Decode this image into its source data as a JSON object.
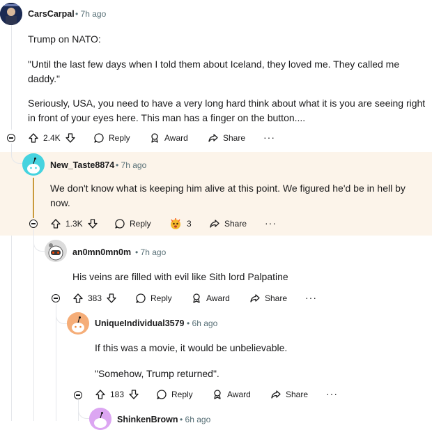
{
  "comments": [
    {
      "username": "CarsCarpal",
      "age": "7h ago",
      "paragraphs": [
        "Trump on NATO:",
        "\"Until the last few days when I told them about Iceland, they loved me. They called me daddy.\"",
        "Seriously, USA, you need to have a very long hard think about what it is you are seeing right in front of your eyes here. This man has a finger on the button...."
      ],
      "votes": "2.4K",
      "reply": "Reply",
      "award": "Award",
      "share": "Share",
      "more": "···"
    },
    {
      "username": "New_Taste8874",
      "age": "7h ago",
      "paragraphs": [
        "We don't know what is keeping him alive at this point. We figured he'd be in hell by now."
      ],
      "votes": "1.3K",
      "reply": "Reply",
      "award_count": "3",
      "share": "Share",
      "more": "···"
    },
    {
      "username": "an0mn0mn0m",
      "age": "7h ago",
      "paragraphs": [
        "His veins are filled with evil like Sith lord Palpatine"
      ],
      "votes": "383",
      "reply": "Reply",
      "award": "Award",
      "share": "Share",
      "more": "···"
    },
    {
      "username": "UniqueIndividual3579",
      "age": "6h ago",
      "paragraphs": [
        "If this was a movie, it would be unbelievable.",
        "\"Somehow, Trump returned\"."
      ],
      "votes": "183",
      "reply": "Reply",
      "award": "Award",
      "share": "Share",
      "more": "···"
    },
    {
      "username": "ShinkenBrown",
      "age": "6h ago"
    }
  ],
  "colors": {
    "highlight": "#fcf4ea",
    "accent_line": "#c99a3b",
    "meta": "#576f76"
  },
  "icons": [
    "upvote-icon",
    "downvote-icon",
    "comment-icon",
    "award-icon",
    "share-icon",
    "more-icon",
    "collapse-icon",
    "award-emoji-icon"
  ]
}
